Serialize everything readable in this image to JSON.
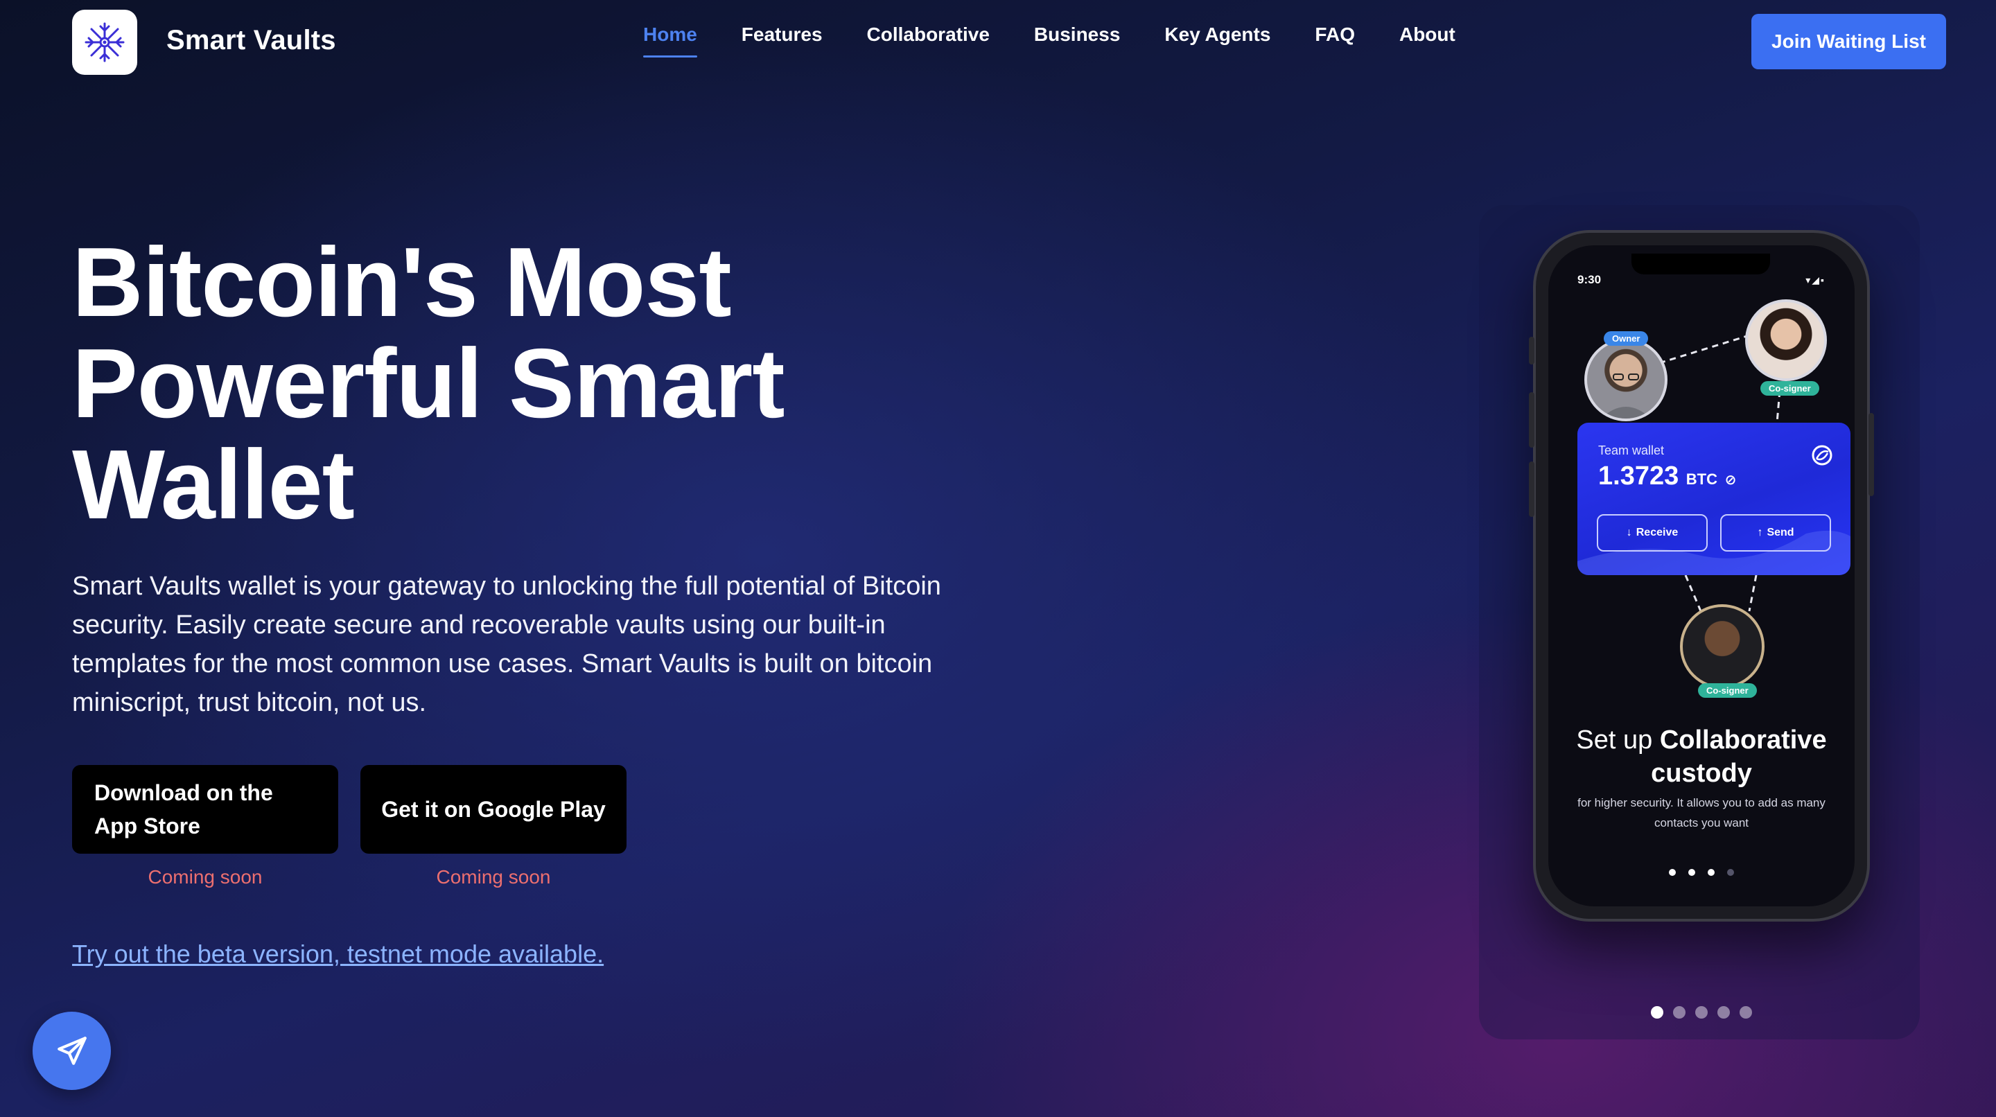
{
  "nav": {
    "brand": "Smart Vaults",
    "logo_icon": "snowflake-vault-icon",
    "links": [
      {
        "label": "Home",
        "active": true
      },
      {
        "label": "Features",
        "active": false
      },
      {
        "label": "Collaborative",
        "active": false
      },
      {
        "label": "Business",
        "active": false
      },
      {
        "label": "Key Agents",
        "active": false
      },
      {
        "label": "FAQ",
        "active": false
      },
      {
        "label": "About",
        "active": false
      }
    ],
    "cta": "Join Waiting List"
  },
  "hero": {
    "title_lines": [
      "Bitcoin's Most",
      "Powerful Smart",
      "Wallet"
    ],
    "description": "Smart Vaults wallet is your gateway to unlocking the full potential of Bitcoin security. Easily create secure and recoverable vaults using our built-in templates for the most common use cases. Smart Vaults is built on bitcoin miniscript, trust bitcoin, not us.",
    "app_store": {
      "line1": "Download on the",
      "line2": "App Store",
      "note": "Coming soon"
    },
    "google_play": {
      "label": "Get it on Google Play",
      "note": "Coming soon"
    },
    "beta_link": "Try out the beta version, testnet mode available."
  },
  "fab": {
    "icon": "paper-plane-icon"
  },
  "phone": {
    "time": "9:30",
    "owner_tag": "Owner",
    "cosigner_tag_top": "Co-signer",
    "cosigner_tag_bottom": "Co-signer",
    "wallet": {
      "label": "Team wallet",
      "amount": "1.3723",
      "unit": "BTC",
      "receive": "Receive",
      "send": "Send"
    },
    "heading_light": "Set up ",
    "heading_bold1": "Collaborative",
    "heading_bold2": "custody",
    "subtext": "for higher security. It allows you to add as many contacts you want",
    "screen_dots_active": 3,
    "screen_dots_total": 4
  },
  "carousel": {
    "active_index": 0,
    "total": 5
  },
  "colors": {
    "accent": "#3b6ff2",
    "nav_active": "#4d82f0",
    "coming_soon": "#ec6f6f",
    "link": "#8cb4ff",
    "wallet_card": "#2430e8",
    "owner_tag": "#3a86e8",
    "cosigner_tag": "#2fb39a"
  }
}
